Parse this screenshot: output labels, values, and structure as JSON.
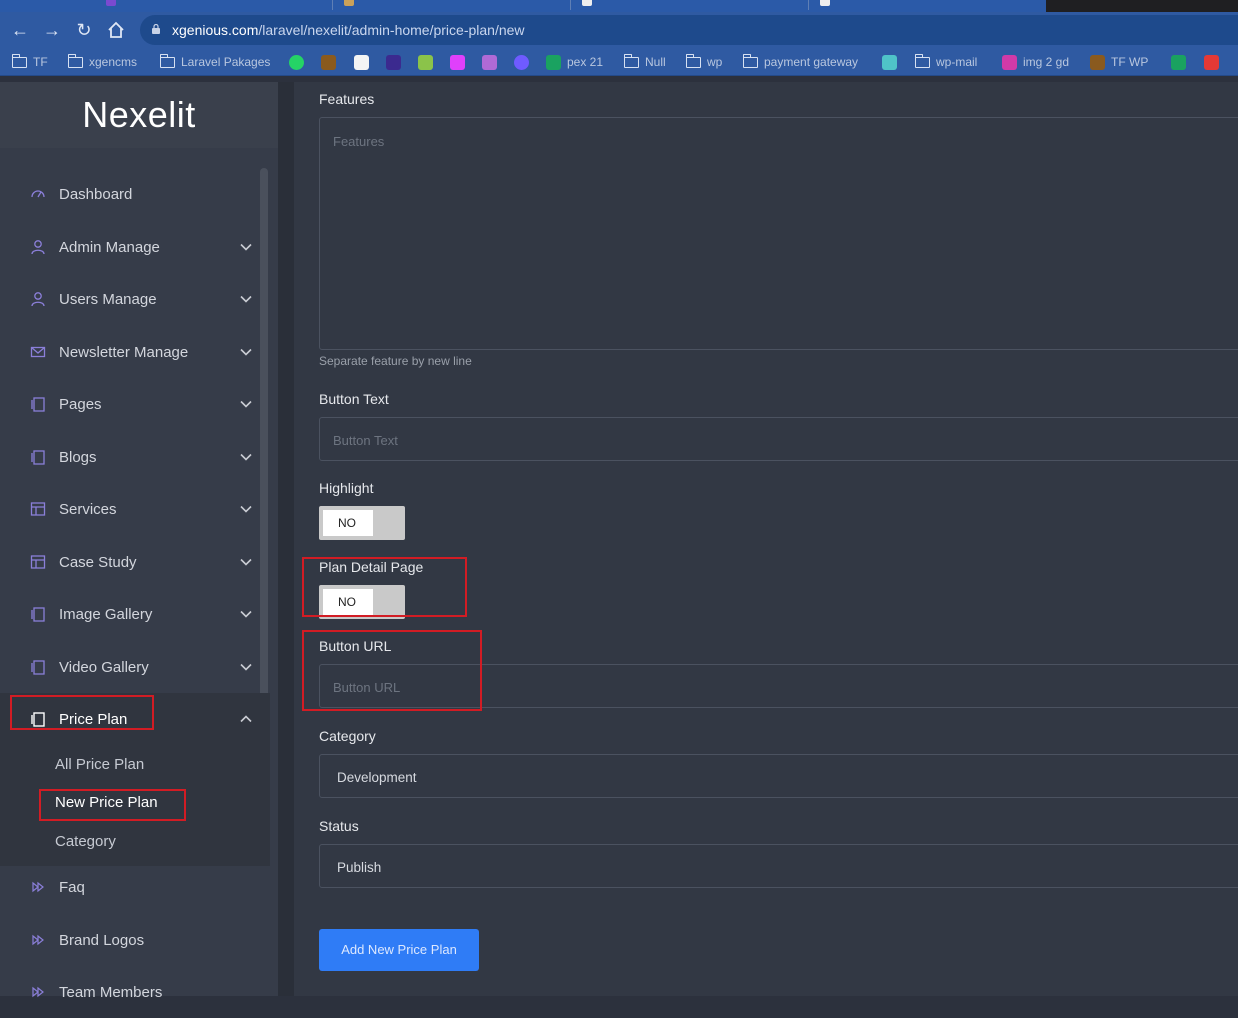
{
  "browser": {
    "url_host": "xgenious.com",
    "url_path": "/laravel/nexelit/admin-home/price-plan/new",
    "bookmarks": [
      "TF",
      "xgencms",
      "Laravel Pakages",
      "pex 21",
      "Null",
      "wp",
      "payment gateway",
      "wp-mail",
      "img 2 gd",
      "TF WP"
    ]
  },
  "sidebar": {
    "brand": "Nexelit",
    "items": [
      {
        "label": "Dashboard",
        "icon": "dashboard-icon"
      },
      {
        "label": "Admin Manage",
        "icon": "user-icon"
      },
      {
        "label": "Users Manage",
        "icon": "user-icon"
      },
      {
        "label": "Newsletter Manage",
        "icon": "envelope-icon"
      },
      {
        "label": "Pages",
        "icon": "pages-icon"
      },
      {
        "label": "Blogs",
        "icon": "pages-icon"
      },
      {
        "label": "Services",
        "icon": "layout-icon"
      },
      {
        "label": "Case Study",
        "icon": "layout-icon"
      },
      {
        "label": "Image Gallery",
        "icon": "pages-icon"
      },
      {
        "label": "Video Gallery",
        "icon": "pages-icon"
      },
      {
        "label": "Price Plan",
        "icon": "pages-icon"
      },
      {
        "label": "Faq",
        "icon": "forward-icon"
      },
      {
        "label": "Brand Logos",
        "icon": "forward-icon"
      },
      {
        "label": "Team Members",
        "icon": "forward-icon"
      }
    ],
    "price_plan_sub": [
      "All Price Plan",
      "New Price Plan",
      "Category"
    ]
  },
  "form": {
    "features_label": "Features",
    "features_placeholder": "Features",
    "features_hint": "Separate feature by new line",
    "button_text_label": "Button Text",
    "button_text_placeholder": "Button Text",
    "highlight_label": "Highlight",
    "highlight_toggle": "NO",
    "plan_detail_label": "Plan Detail Page",
    "plan_detail_toggle": "NO",
    "button_url_label": "Button URL",
    "button_url_placeholder": "Button URL",
    "category_label": "Category",
    "category_value": "Development",
    "status_label": "Status",
    "status_value": "Publish",
    "submit_label": "Add New Price Plan"
  },
  "colors": {
    "accent": "#2f7cf6",
    "icon": "#8b7fd9",
    "annotation": "#d21c24"
  }
}
